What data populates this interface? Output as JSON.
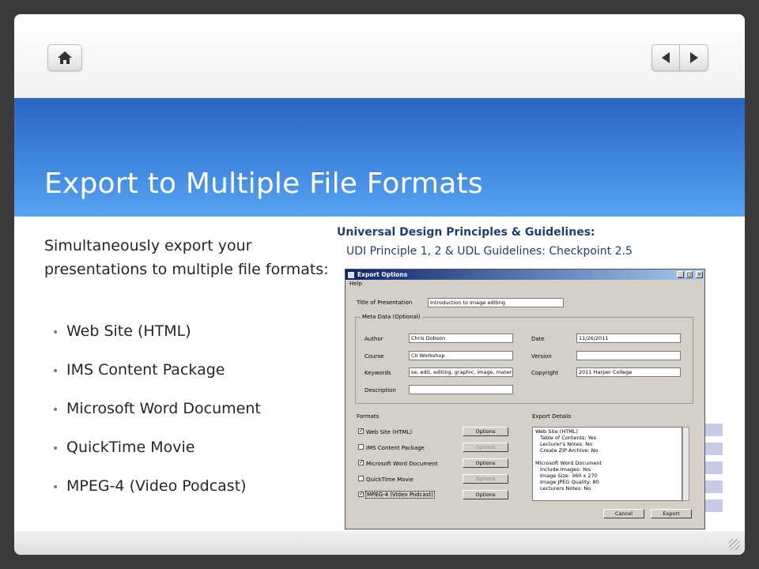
{
  "slide": {
    "title": "Export to Multiple File Formats",
    "intro": "Simultaneously export your presentations to multiple file formats:",
    "bullets": [
      "Web Site (HTML)",
      "IMS Content Package",
      "Microsoft Word Document",
      "QuickTime Movie",
      "MPEG-4 (Video Podcast)"
    ],
    "udl_heading": "Universal Design Principles & Guidelines:",
    "udl_sub": "UDI Principle 1, 2 & UDL Guidelines: Checkpoint 2.5"
  },
  "nav": {
    "home_icon": "home-icon",
    "prev_icon": "triangle-left-icon",
    "next_icon": "triangle-right-icon"
  },
  "dialog": {
    "title": "Export Options",
    "menu": "Help",
    "title_label": "Title of Presentation",
    "title_value": "Introduction to Image editing",
    "meta_label": "Meta Data (Optional)",
    "author_label": "Author",
    "author_value": "Chris Dobson",
    "course_label": "Course",
    "course_value": "CII Workshop",
    "keywords_label": "Keywords",
    "keywords_value": "se, edit, editing, graphic, image, materials",
    "description_label": "Description",
    "description_value": "",
    "date_label": "Date",
    "date_value": "11/26/2011",
    "version_label": "Version",
    "version_value": "",
    "copyright_label": "Copyright",
    "copyright_value": "2011 Harper College",
    "formats_label": "Formats",
    "export_details_label": "Export Details",
    "formats": [
      {
        "label": "Web Site (HTML)",
        "checked": true,
        "options_enabled": true
      },
      {
        "label": "IMS Content Package",
        "checked": false,
        "options_enabled": false
      },
      {
        "label": "Microsoft Word Document",
        "checked": true,
        "options_enabled": true
      },
      {
        "label": "QuickTime Movie",
        "checked": false,
        "options_enabled": false
      },
      {
        "label": "MPEG-4 (Video Podcast)",
        "checked": true,
        "options_enabled": true
      }
    ],
    "options_label": "Options",
    "details": [
      {
        "text": "Web Site (HTML)",
        "indent": false
      },
      {
        "text": "Table of Contents: Yes",
        "indent": true
      },
      {
        "text": "Lecturer's Notes: No",
        "indent": true
      },
      {
        "text": "Create ZIP Archive: No",
        "indent": true
      },
      {
        "text": "",
        "indent": false
      },
      {
        "text": "Microsoft Word Document",
        "indent": false
      },
      {
        "text": "Include Images: Yes",
        "indent": true
      },
      {
        "text": "Image Size: 360 x 270",
        "indent": true
      },
      {
        "text": "Image JPEG Quality: 80",
        "indent": true
      },
      {
        "text": "Lecturers Notes: No",
        "indent": true
      }
    ],
    "cancel_label": "Cancel",
    "export_label": "Export"
  }
}
